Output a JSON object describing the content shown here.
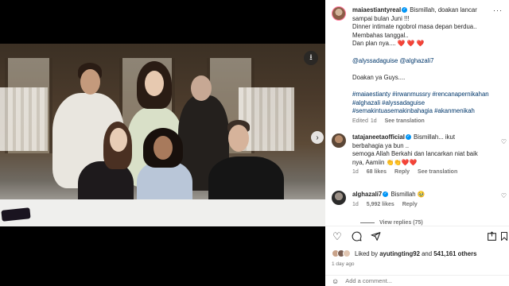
{
  "post": {
    "author": "maiaestiantyreal",
    "caption_lines": [
      "Bismillah, doakan lancar",
      "sampai bulan Juni !!!",
      "Dinner intimate ngobrol masa depan berdua..",
      "Membahas tanggal..",
      "Dan plan nya...."
    ],
    "caption_hearts": "❤️ ❤️ ❤️",
    "mentions": "@alyssadaguise @alghazali7",
    "doakan": "Doakan ya Guys....",
    "hashtags": [
      "#maiaestianty #irwanmussry #rencanapernikahan",
      "#alghazali #alyssadaguise",
      "#semakintuasemakinbahagia #akanmenikah"
    ],
    "meta_edited": "Edited",
    "meta_age": "1d",
    "meta_translation": "See translation"
  },
  "comments": [
    {
      "username": "tatajaneetaofficial",
      "lines": [
        "Bismillah... ikut",
        "berbahagia ya bun ..",
        "semoga Allah Berkahi dan lancarkan niat baik",
        "nya, Aamiin"
      ],
      "emojis": "👏👏❤️❤️",
      "age": "1d",
      "likes": "68 likes",
      "reply": "Reply",
      "translation": "See translation"
    },
    {
      "username": "alghazali7",
      "text": "Bismillah",
      "emojis": "🥹",
      "age": "1d",
      "likes": "5,992 likes",
      "reply": "Reply"
    }
  ],
  "view_replies": "View replies (75)",
  "likes": {
    "prefix": "Liked by",
    "user": "ayutingting92",
    "conj": "and",
    "count": "541,161 others"
  },
  "date": "1 day ago",
  "add_comment_placeholder": "Add a comment...",
  "icons": {
    "heart": "heart-icon",
    "comment": "comment-icon",
    "share": "share-icon",
    "save": "bookmark-icon",
    "more": "more-icon",
    "download": "download-icon",
    "next": "chevron-right-icon",
    "emoji": "emoji-icon"
  },
  "colors": {
    "link": "#00376b",
    "verified": "#0095f6",
    "secondary_text": "#737373",
    "heart_red": "#ed4956"
  }
}
